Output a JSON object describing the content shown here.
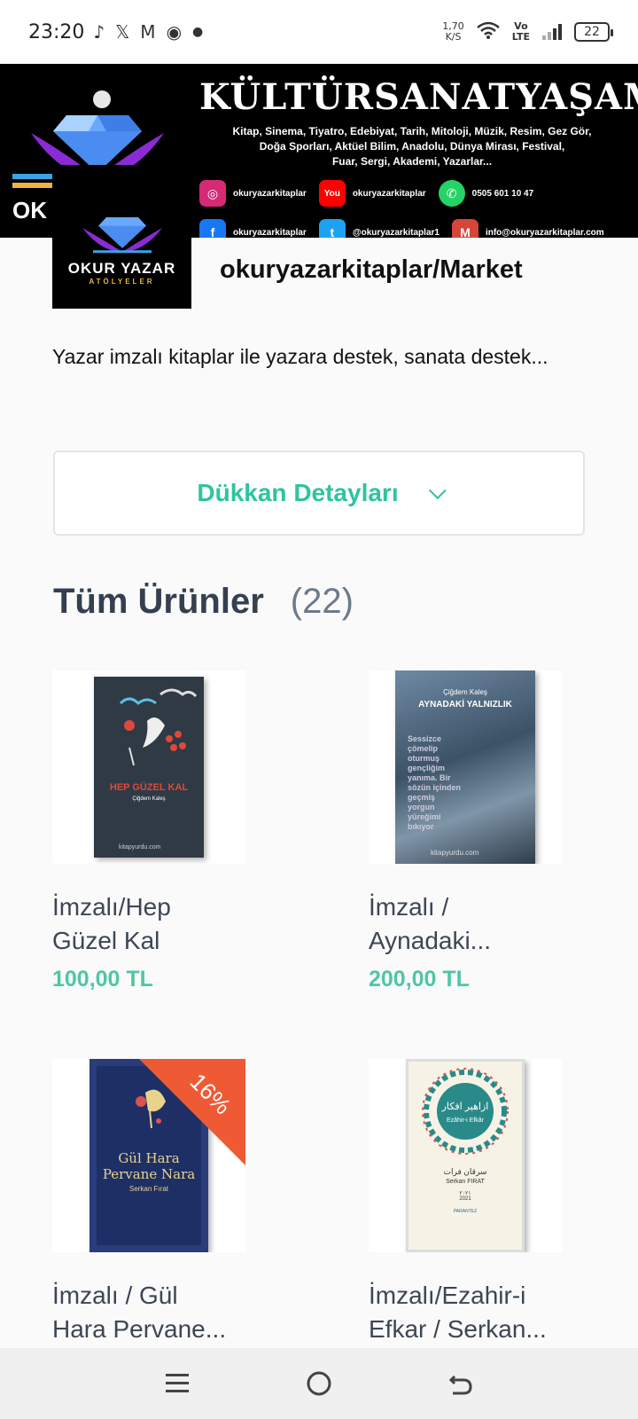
{
  "status_bar": {
    "time": "23:20",
    "left_icons": [
      "tiktok-icon",
      "x-icon",
      "gmail-icon",
      "chrome-icon",
      "dot-icon"
    ],
    "speed_value": "1,70",
    "speed_unit": "K/S",
    "lte_top": "Vo",
    "lte_bottom": "LTE",
    "battery": "22"
  },
  "banner": {
    "title_words": [
      "KÜLTÜR",
      "SANAT",
      "YAŞAM"
    ],
    "subtitle_line1": "Kitap, Sinema, Tiyatro, Edebiyat, Tarih, Mitoloji, Müzik, Resim, Gez Gör,",
    "subtitle_line2": "Doğa Sporları, Aktüel Bilim, Anadolu, Dünya Mirası, Festival,",
    "subtitle_line3": "Fuar, Sergi, Akademi, Yazarlar...",
    "left_label": "OK",
    "social": [
      {
        "icon": "instagram-icon",
        "text": "okuryazarkitaplar",
        "color": "#d62976",
        "glyph": "◎"
      },
      {
        "icon": "youtube-icon",
        "text": "okuryazarkitaplar",
        "color": "#ff0000",
        "glyph": "You"
      },
      {
        "icon": "whatsapp-icon",
        "text": "0505 601 10 47",
        "color": "#25d366",
        "glyph": "✆"
      },
      {
        "icon": "facebook-icon",
        "text": "okuryazarkitaplar",
        "color": "#1877f2",
        "glyph": "f"
      },
      {
        "icon": "twitter-icon",
        "text": "@okuryazarkitaplar1",
        "color": "#1da1f2",
        "glyph": "t"
      },
      {
        "icon": "mail-icon",
        "text": "info@okuryazarkitaplar.com",
        "color": "#d44638",
        "glyph": "M"
      }
    ]
  },
  "logo": {
    "name": "OKUR YAZAR",
    "sub": "ATÖLYELER"
  },
  "store": {
    "title": "okuryazarkitaplar/Market",
    "description": "Yazar imzalı kitaplar ile yazara destek, sanata destek...",
    "details_label": "Dükkan Detayları"
  },
  "products_section": {
    "title": "Tüm Ürünler",
    "count": "(22)"
  },
  "products": [
    {
      "name_line1": "İmzalı/Hep",
      "name_line2": "Güzel Kal",
      "price": "100,00 TL",
      "cover_title": "HEP GÜZEL KAL",
      "cover_author": "Çiğdem Kaleş",
      "cover_footer": "kitapyurdu.com"
    },
    {
      "name_line1": "İmzalı /",
      "name_line2": "Aynadaki...",
      "price": "200,00 TL",
      "cover_author": "Çiğdem Kaleş",
      "cover_title": "AYNADAKİ YALNIZLIK",
      "cover_text": "Sessizce çömelip oturmuş gençliğim yanıma. Bir sözün içinden geçmiş yorgun yüreğimi bıkıyor",
      "cover_footer": "kitapyurdu.com"
    },
    {
      "name_line1": "İmzalı / Gül",
      "name_line2": "Hara Pervane...",
      "badge": "16%",
      "cover_title_line1": "Gül Hara",
      "cover_title_line2": "Pervane Nara",
      "cover_author": "Serkan Fırat"
    },
    {
      "name_line1": "İmzalı/Ezahir-i",
      "name_line2": "Efkar / Serkan...",
      "cover_arabic": "ازاهير افكار",
      "cover_subtitle": "Ezâhir-i Efkâr",
      "cover_arabic_author": "سرقان فرات",
      "cover_author": "Serkan FIRAT",
      "cover_year_arabic": "٢٠٢١",
      "cover_year": "2021",
      "cover_publisher": "PARANTEZ"
    }
  ],
  "nav": {
    "buttons": [
      "menu-icon",
      "home-icon",
      "back-icon"
    ]
  }
}
